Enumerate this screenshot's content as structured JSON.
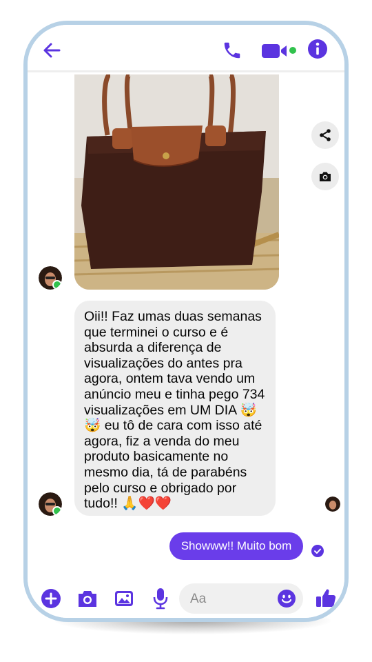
{
  "colors": {
    "accent": "#5b34e0",
    "online": "#31c24d",
    "outgoing_bubble": "#6a3dea",
    "incoming_bubble": "#eeeeee",
    "phone_frame": "#b7d1e6"
  },
  "header": {
    "icons": [
      "back-arrow-icon",
      "phone-call-icon",
      "video-camera-icon",
      "info-icon"
    ]
  },
  "attachment": {
    "actions": [
      "share-icon",
      "camera-icon"
    ]
  },
  "messages": [
    {
      "direction": "incoming",
      "text": "Oii!! Faz umas duas semanas que terminei o curso e é absurda a diferença de visualizações do antes pra agora, ontem tava vendo um anúncio meu e tinha pego 734 visualizações em UM DIA 🤯🤯 eu tô de cara com isso até agora, fiz a venda do meu produto basicamente no mesmo dia, tá de parabéns pelo curso e obrigado por tudo!! 🙏❤️❤️"
    },
    {
      "direction": "outgoing",
      "text": "Showww!! Muito bom"
    }
  ],
  "composer": {
    "placeholder": "Aa",
    "icons": [
      "plus-icon",
      "camera-icon",
      "gallery-icon",
      "microphone-icon",
      "emoji-icon",
      "thumbs-up-icon"
    ]
  }
}
